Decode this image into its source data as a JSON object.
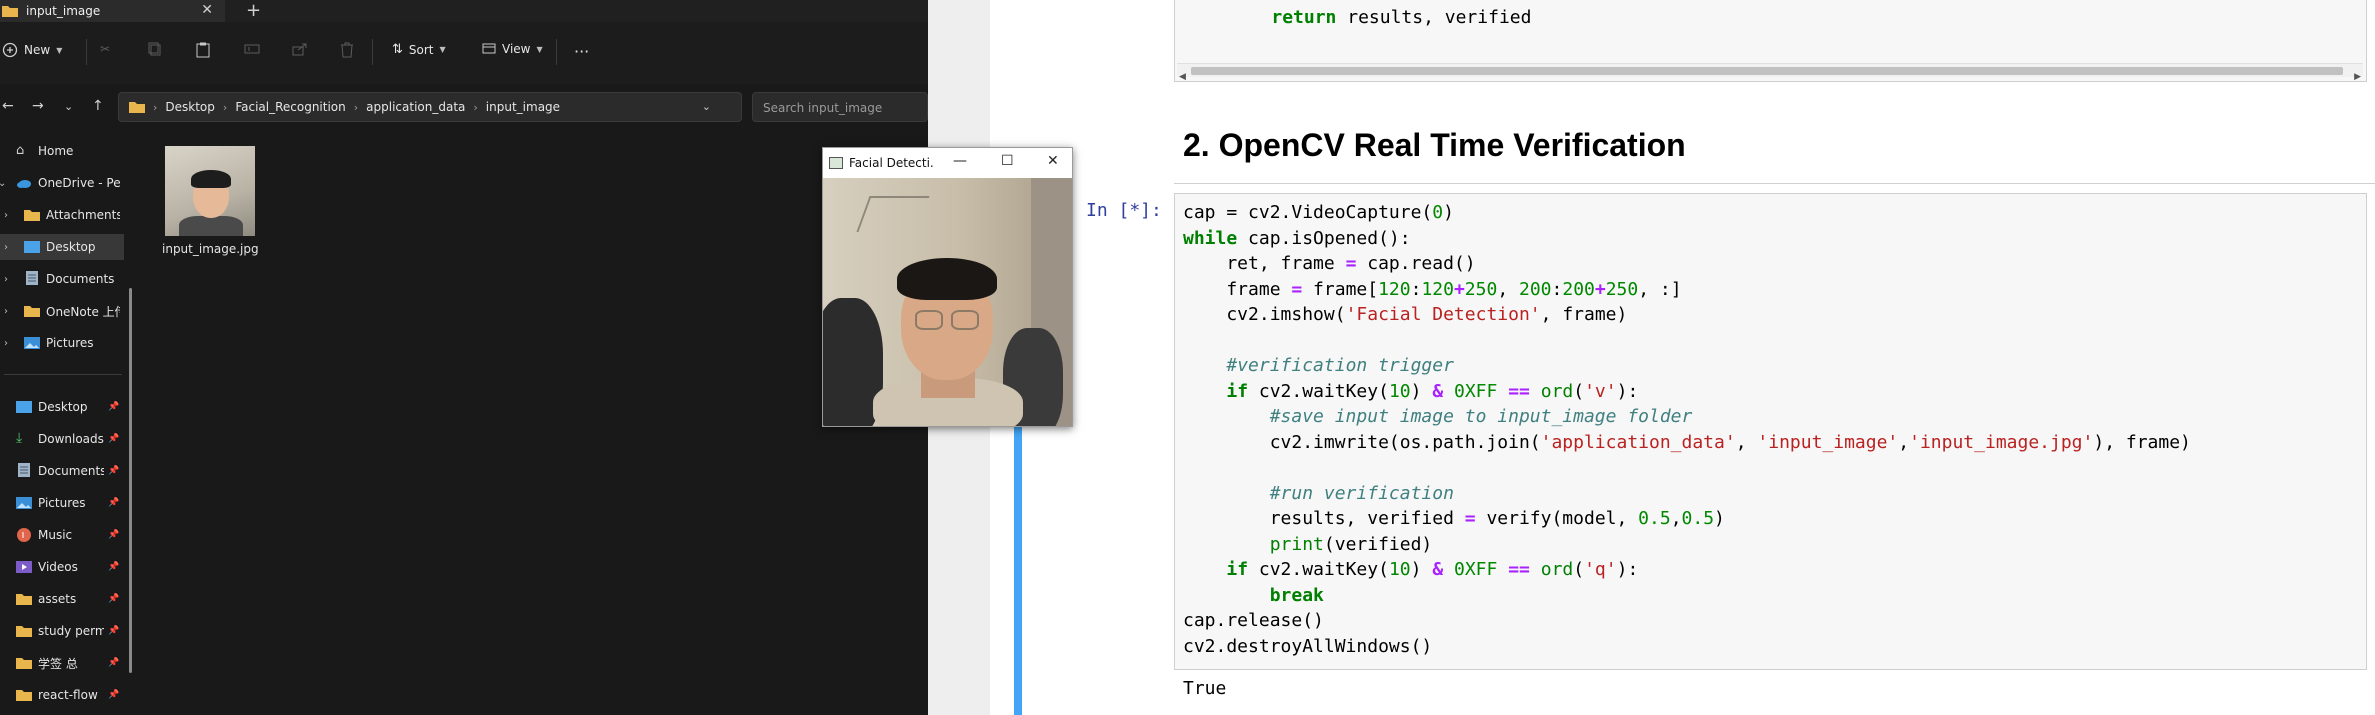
{
  "explorer": {
    "tab_title": "input_image",
    "toolbar": {
      "new_label": "New",
      "sort_label": "Sort",
      "view_label": "View",
      "more_label": "···"
    },
    "breadcrumb": [
      "Desktop",
      "Facial_Recognition",
      "application_data",
      "input_image"
    ],
    "search_placeholder": "Search input_image",
    "nav_tree": [
      {
        "label": "Home",
        "icon": "home-icon"
      },
      {
        "label": "OneDrive - Personal",
        "icon": "cloud-icon"
      },
      {
        "label": "Attachments",
        "icon": "folder-icon"
      },
      {
        "label": "Desktop",
        "icon": "desktop-icon"
      },
      {
        "label": "Documents",
        "icon": "documents-icon"
      },
      {
        "label": "OneNote 上传",
        "icon": "folder-icon"
      },
      {
        "label": "Pictures",
        "icon": "pictures-icon"
      }
    ],
    "quick_access": [
      {
        "label": "Desktop",
        "icon": "desktop-icon"
      },
      {
        "label": "Downloads",
        "icon": "download-icon"
      },
      {
        "label": "Documents",
        "icon": "documents-icon"
      },
      {
        "label": "Pictures",
        "icon": "pictures-icon"
      },
      {
        "label": "Music",
        "icon": "music-icon"
      },
      {
        "label": "Videos",
        "icon": "videos-icon"
      },
      {
        "label": "assets",
        "icon": "folder-icon"
      },
      {
        "label": "study permit",
        "icon": "folder-icon"
      },
      {
        "label": "学签 总",
        "icon": "folder-icon"
      },
      {
        "label": "react-flow",
        "icon": "folder-icon"
      }
    ],
    "file": {
      "name": "input_image.jpg"
    }
  },
  "cv_window": {
    "title": "Facial Detecti..."
  },
  "notebook": {
    "prev_cell_line": {
      "indent": "    ",
      "kw": "return",
      "rest": " results, verified"
    },
    "heading": "2. OpenCV Real Time Verification",
    "prompt": "In [*]:",
    "code_lines": [
      [
        {
          "t": "cap = cv2.VideoCapture(",
          "c": ""
        },
        {
          "t": "0",
          "c": "n"
        },
        {
          "t": ")",
          "c": ""
        }
      ],
      [
        {
          "t": "while",
          "c": "k"
        },
        {
          "t": " cap.isOpened():",
          "c": ""
        }
      ],
      [
        {
          "t": "    ret, frame ",
          "c": ""
        },
        {
          "t": "=",
          "c": "o"
        },
        {
          "t": " cap.read()",
          "c": ""
        }
      ],
      [
        {
          "t": "    frame ",
          "c": ""
        },
        {
          "t": "=",
          "c": "o"
        },
        {
          "t": " frame[",
          "c": ""
        },
        {
          "t": "120",
          "c": "n"
        },
        {
          "t": ":",
          "c": ""
        },
        {
          "t": "120",
          "c": "n"
        },
        {
          "t": "+",
          "c": "o"
        },
        {
          "t": "250",
          "c": "n"
        },
        {
          "t": ", ",
          "c": ""
        },
        {
          "t": "200",
          "c": "n"
        },
        {
          "t": ":",
          "c": ""
        },
        {
          "t": "200",
          "c": "n"
        },
        {
          "t": "+",
          "c": "o"
        },
        {
          "t": "250",
          "c": "n"
        },
        {
          "t": ", :]",
          "c": ""
        }
      ],
      [
        {
          "t": "    cv2.imshow(",
          "c": ""
        },
        {
          "t": "'Facial Detection'",
          "c": "s"
        },
        {
          "t": ", frame)",
          "c": ""
        }
      ],
      [
        {
          "t": "",
          "c": ""
        }
      ],
      [
        {
          "t": "    ",
          "c": ""
        },
        {
          "t": "#verification trigger",
          "c": "c"
        }
      ],
      [
        {
          "t": "    ",
          "c": ""
        },
        {
          "t": "if",
          "c": "k"
        },
        {
          "t": " cv2.waitKey(",
          "c": ""
        },
        {
          "t": "10",
          "c": "n"
        },
        {
          "t": ") ",
          "c": ""
        },
        {
          "t": "&",
          "c": "o"
        },
        {
          "t": " ",
          "c": ""
        },
        {
          "t": "0XFF",
          "c": "n"
        },
        {
          "t": " ",
          "c": ""
        },
        {
          "t": "==",
          "c": "o"
        },
        {
          "t": " ",
          "c": ""
        },
        {
          "t": "ord",
          "c": "bi"
        },
        {
          "t": "(",
          "c": ""
        },
        {
          "t": "'v'",
          "c": "s"
        },
        {
          "t": "):",
          "c": ""
        }
      ],
      [
        {
          "t": "        ",
          "c": ""
        },
        {
          "t": "#save input image to input_image folder",
          "c": "c"
        }
      ],
      [
        {
          "t": "        cv2.imwrite(os.path.join(",
          "c": ""
        },
        {
          "t": "'application_data'",
          "c": "s"
        },
        {
          "t": ", ",
          "c": ""
        },
        {
          "t": "'input_image'",
          "c": "s"
        },
        {
          "t": ",",
          "c": ""
        },
        {
          "t": "'input_image.jpg'",
          "c": "s"
        },
        {
          "t": "), frame)",
          "c": ""
        }
      ],
      [
        {
          "t": "",
          "c": ""
        }
      ],
      [
        {
          "t": "        ",
          "c": ""
        },
        {
          "t": "#run verification",
          "c": "c"
        }
      ],
      [
        {
          "t": "        results, verified ",
          "c": ""
        },
        {
          "t": "=",
          "c": "o"
        },
        {
          "t": " verify(model, ",
          "c": ""
        },
        {
          "t": "0.5",
          "c": "n"
        },
        {
          "t": ",",
          "c": ""
        },
        {
          "t": "0.5",
          "c": "n"
        },
        {
          "t": ")",
          "c": ""
        }
      ],
      [
        {
          "t": "        ",
          "c": ""
        },
        {
          "t": "print",
          "c": "bi"
        },
        {
          "t": "(verified)",
          "c": ""
        }
      ],
      [
        {
          "t": "    ",
          "c": ""
        },
        {
          "t": "if",
          "c": "k"
        },
        {
          "t": " cv2.waitKey(",
          "c": ""
        },
        {
          "t": "10",
          "c": "n"
        },
        {
          "t": ") ",
          "c": ""
        },
        {
          "t": "&",
          "c": "o"
        },
        {
          "t": " ",
          "c": ""
        },
        {
          "t": "0XFF",
          "c": "n"
        },
        {
          "t": " ",
          "c": ""
        },
        {
          "t": "==",
          "c": "o"
        },
        {
          "t": " ",
          "c": ""
        },
        {
          "t": "ord",
          "c": "bi"
        },
        {
          "t": "(",
          "c": ""
        },
        {
          "t": "'q'",
          "c": "s"
        },
        {
          "t": "):",
          "c": ""
        }
      ],
      [
        {
          "t": "        ",
          "c": ""
        },
        {
          "t": "break",
          "c": "k"
        }
      ],
      [
        {
          "t": "cap.release()",
          "c": ""
        }
      ],
      [
        {
          "t": "cv2.destroyAllWindows()",
          "c": ""
        }
      ]
    ],
    "output": "True"
  }
}
